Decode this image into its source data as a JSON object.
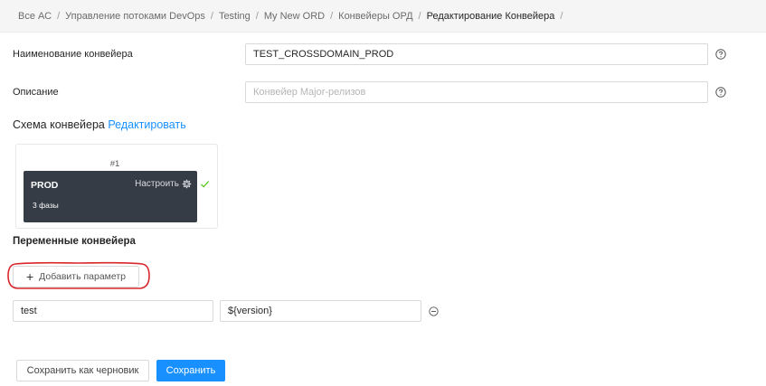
{
  "breadcrumb": {
    "items": [
      "Все АС",
      "Управление потоками DevOps",
      "Testing",
      "My New ORD",
      "Конвейеры ОРД",
      "Редактирование Конвейера"
    ],
    "separator": "/"
  },
  "form": {
    "name_label": "Наименование конвейера",
    "name_value": "TEST_CROSSDOMAIN_PROD",
    "description_label": "Описание",
    "description_placeholder": "Конвейер Major-релизов",
    "help_icon": "question-circle-icon"
  },
  "scheme": {
    "title": "Схема конвейера",
    "edit_link": "Редактировать",
    "stage": {
      "number": "#1",
      "name": "PROD",
      "phases": "3 фазы",
      "configure_label": "Настроить",
      "configure_icon": "gear-icon",
      "status_icon": "check-icon",
      "status_color": "#52c41a",
      "box_color": "#353c46"
    }
  },
  "variables": {
    "title": "Переменные конвейера",
    "add_label": "Добавить параметр",
    "rows": [
      {
        "key": "test",
        "value": "${version}"
      }
    ]
  },
  "actions": {
    "draft_label": "Сохранить как черновик",
    "save_label": "Сохранить"
  },
  "colors": {
    "accent": "#1890ff",
    "annotation": "#d9262b"
  }
}
